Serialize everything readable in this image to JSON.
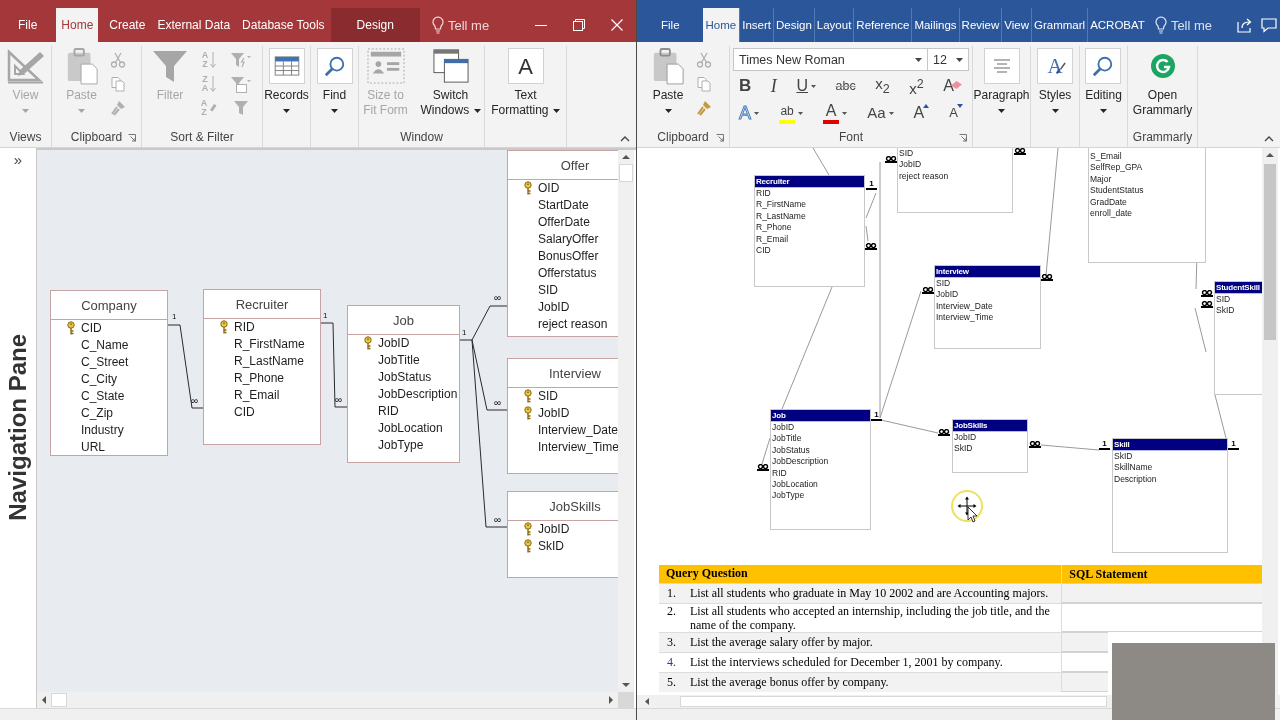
{
  "access": {
    "tabs": [
      {
        "label": "File",
        "selected": false,
        "contextual": false
      },
      {
        "label": "Home",
        "selected": true,
        "contextual": false
      },
      {
        "label": "Create",
        "selected": false,
        "contextual": false
      },
      {
        "label": "External Data",
        "selected": false,
        "contextual": false
      },
      {
        "label": "Database Tools",
        "selected": false,
        "contextual": false
      },
      {
        "label": "Design",
        "selected": false,
        "contextual": true
      }
    ],
    "tell_me": {
      "placeholder": "Tell me"
    },
    "ribbon": {
      "views": {
        "label": "Views",
        "view": {
          "label": "View",
          "disabled": true
        }
      },
      "clipboard": {
        "label": "Clipboard",
        "paste": {
          "label": "Paste",
          "disabled": true
        },
        "tools": [
          {
            "disabled": true
          },
          {
            "disabled": true
          },
          {
            "disabled": true
          }
        ]
      },
      "sort_filter": {
        "label": "Sort & Filter",
        "filter": {
          "label": "Filter",
          "disabled": true
        },
        "sort_tools": [
          {
            "top": "A",
            "bottom": "Z",
            "disabled": true
          },
          {
            "top": "Z",
            "bottom": "A",
            "disabled": true
          },
          {
            "top": "A",
            "bottom": "Z",
            "disabled": true
          }
        ],
        "filter_tools": [
          {
            "disabled": true
          },
          {
            "disabled": true
          },
          {
            "disabled": true
          }
        ]
      },
      "records": {
        "label": "Records"
      },
      "find": {
        "label": "Find"
      },
      "window": {
        "label": "Window",
        "size_to_fit": {
          "label": "Size to Fit Form",
          "disabled": true
        },
        "switch_windows": {
          "label": "Switch Windows",
          "disabled": false
        }
      },
      "text_formatting": {
        "label": "Text Formatting",
        "glyph": "A"
      }
    },
    "nav_pane": {
      "toggle": "»",
      "label": "Navigation Pane"
    },
    "tables": [
      {
        "title": "Company",
        "fields": [
          {
            "name": "CID",
            "key": true
          },
          {
            "name": "C_Name",
            "key": false
          },
          {
            "name": "C_Street",
            "key": false
          },
          {
            "name": "C_City",
            "key": false
          },
          {
            "name": "C_State",
            "key": false
          },
          {
            "name": "C_Zip",
            "key": false
          },
          {
            "name": "Industry",
            "key": false
          },
          {
            "name": "URL",
            "key": false
          }
        ]
      },
      {
        "title": "Recruiter",
        "fields": [
          {
            "name": "RID",
            "key": true
          },
          {
            "name": "R_FirstName",
            "key": false
          },
          {
            "name": "R_LastName",
            "key": false
          },
          {
            "name": "R_Phone",
            "key": false
          },
          {
            "name": "R_Email",
            "key": false
          },
          {
            "name": "CID",
            "key": false
          }
        ]
      },
      {
        "title": "Job",
        "fields": [
          {
            "name": "JobID",
            "key": true
          },
          {
            "name": "JobTitle",
            "key": false
          },
          {
            "name": "JobStatus",
            "key": false
          },
          {
            "name": "JobDescription",
            "key": false
          },
          {
            "name": "RID",
            "key": false
          },
          {
            "name": "JobLocation",
            "key": false
          },
          {
            "name": "JobType",
            "key": false
          }
        ]
      },
      {
        "title": "Offer",
        "fields": [
          {
            "name": "OID",
            "key": true
          },
          {
            "name": "StartDate",
            "key": false
          },
          {
            "name": "OfferDate",
            "key": false
          },
          {
            "name": "SalaryOffer",
            "key": false
          },
          {
            "name": "BonusOffer",
            "key": false
          },
          {
            "name": "Offerstatus",
            "key": false
          },
          {
            "name": "SID",
            "key": false
          },
          {
            "name": "JobID",
            "key": false
          },
          {
            "name": "reject reason",
            "key": false
          }
        ]
      },
      {
        "title": "Interview",
        "fields": [
          {
            "name": "SID",
            "key": true
          },
          {
            "name": "JobID",
            "key": true
          },
          {
            "name": "Interview_Date",
            "key": false
          },
          {
            "name": "Interview_Time",
            "key": false
          }
        ]
      },
      {
        "title": "JobSkills",
        "fields": [
          {
            "name": "JobID",
            "key": true
          },
          {
            "name": "SkID",
            "key": true
          }
        ]
      }
    ],
    "relationships": [
      {
        "one": "1",
        "many": "∞"
      },
      {
        "one": "1",
        "many": "∞"
      },
      {
        "one": "1",
        "many": "∞"
      },
      {
        "many": "∞"
      },
      {
        "many": "∞"
      }
    ]
  },
  "word": {
    "tabs": [
      {
        "label": "File",
        "selected": false
      },
      {
        "label": "Home",
        "selected": true
      },
      {
        "label": "Insert",
        "selected": false
      },
      {
        "label": "Design",
        "selected": false
      },
      {
        "label": "Layout",
        "selected": false
      },
      {
        "label": "Reference",
        "selected": false
      },
      {
        "label": "Mailings",
        "selected": false
      },
      {
        "label": "Review",
        "selected": false
      },
      {
        "label": "View",
        "selected": false
      },
      {
        "label": "Grammarl",
        "selected": false
      },
      {
        "label": "ACROBAT",
        "selected": false
      }
    ],
    "tell_me": {
      "placeholder": "Tell me"
    },
    "ribbon": {
      "clipboard": {
        "label": "Clipboard",
        "paste": {
          "label": "Paste",
          "disabled": false
        },
        "tools": [
          {
            "disabled": true
          },
          {
            "disabled": true
          },
          {
            "disabled": false
          }
        ]
      },
      "font": {
        "label": "Font",
        "font_name": "Times New Roman",
        "font_size": "12",
        "row_1": [
          {
            "kind": "bold",
            "glyph": "B",
            "dropdown": false
          },
          {
            "kind": "italic",
            "glyph": "I",
            "dropdown": false
          },
          {
            "kind": "underline",
            "glyph": "U",
            "dropdown": true
          },
          {
            "kind": "strikethrough",
            "glyph": "abc",
            "dropdown": false
          },
          {
            "kind": "subscript",
            "glyph": "x$_{2}$",
            "dropdown": false
          },
          {
            "kind": "superscript",
            "glyph": "x$^{2}$",
            "dropdown": false
          },
          {
            "kind": "clear",
            "glyph": "A",
            "dropdown": false
          }
        ],
        "row_2": [
          {
            "kind": "effects",
            "glyph": "A",
            "dropdown": true
          },
          {
            "kind": "highlight",
            "glyph": "ab",
            "dropdown": true,
            "color": "#ffff00"
          },
          {
            "kind": "font_color",
            "glyph": "A",
            "dropdown": true,
            "color": "#e00000"
          },
          {
            "kind": "case",
            "glyph": "Aa",
            "dropdown": true
          },
          {
            "kind": "grow",
            "glyph": "A",
            "dropdown": false
          },
          {
            "kind": "shrink",
            "glyph": "A",
            "dropdown": false
          }
        ]
      },
      "paragraph": {
        "label": "Paragraph"
      },
      "styles": {
        "label": "Styles",
        "glyph": "A"
      },
      "editing": {
        "label": "Editing"
      },
      "grammarly": {
        "label": "Grammarly",
        "open": {
          "label": "Open Grammarly"
        }
      }
    },
    "diagram": {
      "tables": [
        {
          "fields": [
            "SID",
            "JobID",
            "reject reason"
          ]
        },
        {
          "title": "Recruiter",
          "fields": [
            "RID",
            "R_FirstName",
            "R_LastName",
            "R_Phone",
            "R_Email",
            "CID"
          ]
        },
        {
          "fields": [
            "S_Email",
            "SelfRep_GPA",
            "Major",
            "StudentStatus",
            "GradDate",
            "enroll_date"
          ]
        },
        {
          "title": "Interview",
          "fields": [
            "SID",
            "JobID",
            "Interview_Date",
            "Interview_Time"
          ]
        },
        {
          "title": "StudentSkill",
          "fields": [
            "SID",
            "SkID"
          ]
        },
        {
          "title": "Job",
          "fields": [
            "JobID",
            "JobTitle",
            "JobStatus",
            "JobDescription",
            "RID",
            "JobLocation",
            "JobType"
          ]
        },
        {
          "title": "JobSkills",
          "fields": [
            "JobID",
            "SkID"
          ]
        },
        {
          "title": "Skill",
          "fields": [
            "SkID",
            "SkillName",
            "Description"
          ]
        }
      ],
      "one_labels": [
        "1",
        "1",
        "1",
        "1"
      ]
    },
    "query_table": {
      "columns": [
        "Query Question",
        "SQL Statement"
      ],
      "rows": [
        {
          "number": "1.",
          "question": "List all students who graduate in May 10 2002 and are Accounting majors."
        },
        {
          "number": "2.",
          "question": "List all students who accepted an internship, including the job title, and the name of the company."
        },
        {
          "number": "3.",
          "question": "List the average salary offer by major."
        },
        {
          "number": "4.",
          "color": "#3535a0",
          "question": "List the interviews scheduled for December 1, 2001 by company."
        },
        {
          "number": "5.",
          "question": "List the average bonus offer by company."
        }
      ]
    }
  }
}
